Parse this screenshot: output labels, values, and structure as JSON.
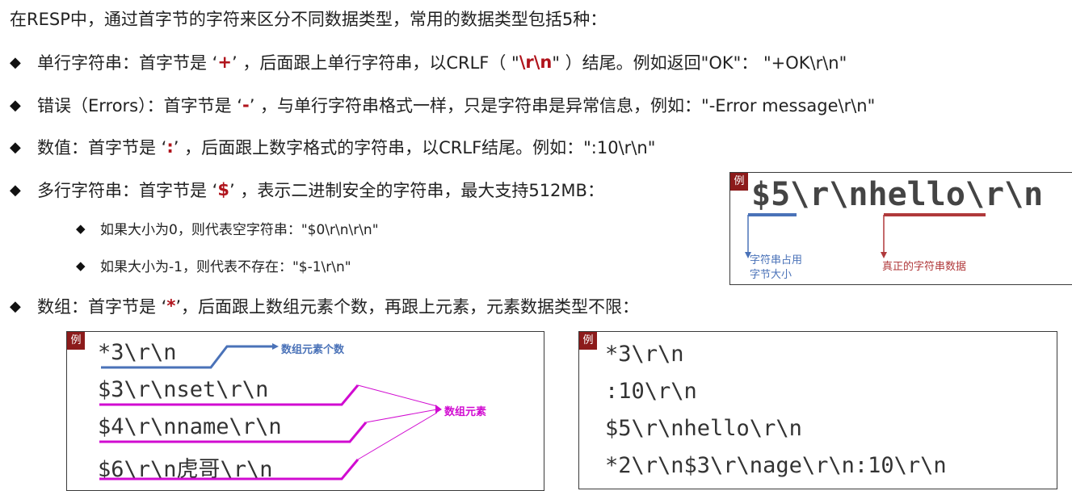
{
  "intro": "在RESP中，通过首字节的字符来区分不同数据类型，常用的数据类型包括5种：",
  "items": [
    {
      "pre": "单行字符串：首字节是 ‘",
      "mark": "+",
      "post": "’ ，后面跟上单行字符串，以CRLF（ \"",
      "crlf": "\\r\\n",
      "tail": "\" ）结尾。例如返回\"OK\"： \"+OK\\r\\n\""
    },
    {
      "pre": "错误（Errors）：首字节是 ‘",
      "mark": "-",
      "post": "’ ，与单行字符串格式一样，只是字符串是异常信息，例如：\"-Error message\\r\\n\""
    },
    {
      "pre": "数值：首字节是 ‘",
      "mark": ":",
      "post": "’ ，后面跟上数字格式的字符串，以CRLF结尾。例如：\":10\\r\\n\""
    },
    {
      "pre": "多行字符串：首字节是 ‘",
      "mark": "$",
      "post": "’ ，表示二进制安全的字符串，最大支持512MB："
    },
    {
      "pre": "数组：首字节是 ‘",
      "mark": "*",
      "post": "’，后面跟上数组元素个数，再跟上元素，元素数据类型不限："
    }
  ],
  "sub_items": [
    "如果大小为0，则代表空字符串：\"$0\\r\\n\\r\\n\"",
    "如果大小为-1，则代表不存在：\"$-1\\r\\n\""
  ],
  "example_tag": "例",
  "bulk_example": {
    "code": "$5\\r\\nhello\\r\\n",
    "note_size": "字符串占用\n字节大小",
    "note_data": "真正的字符串数据",
    "colors": {
      "blue": "#4a72b8",
      "red": "#b0393b"
    }
  },
  "array_example": {
    "lines": [
      "*3\\r\\n",
      "$3\\r\\nset\\r\\n",
      "$4\\r\\nname\\r\\n",
      "$6\\r\\n虎哥\\r\\n"
    ],
    "note_count": "数组元素个数",
    "note_elements": "数组元素",
    "colors": {
      "blue": "#4a72b8",
      "magenta": "#d10bd1"
    }
  },
  "array_example2": {
    "lines": [
      "*3\\r\\n",
      ":10\\r\\n",
      "$5\\r\\nhello\\r\\n",
      "*2\\r\\n$3\\r\\nage\\r\\n:10\\r\\n"
    ]
  }
}
